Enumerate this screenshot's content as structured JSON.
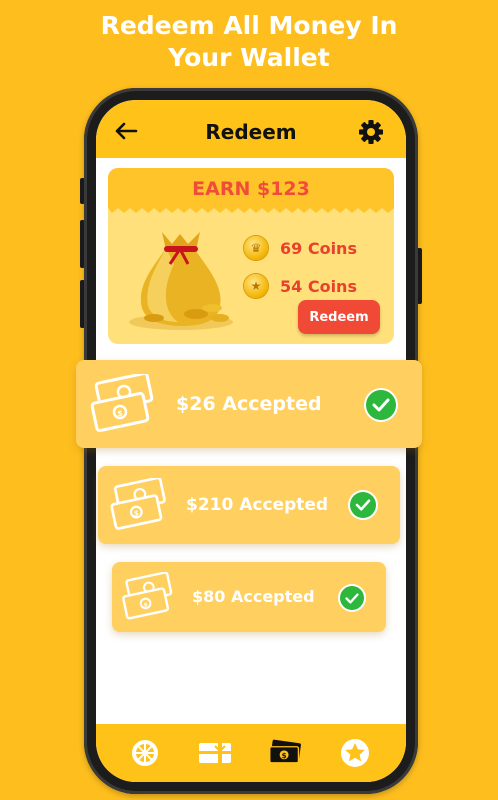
{
  "headline": {
    "line1": "Redeem All Money In",
    "line2": "Your Wallet"
  },
  "header": {
    "title": "Redeem"
  },
  "earn_card": {
    "title": "EARN $123",
    "coins": [
      {
        "value": "69 Coins",
        "icon": "crown-coin-icon"
      },
      {
        "value": "54 Coins",
        "icon": "star-coin-icon"
      }
    ],
    "redeem_label": "Redeem"
  },
  "accepted": [
    {
      "text": "$26 Accepted"
    },
    {
      "text": "$210 Accepted"
    },
    {
      "text": "$80 Accepted"
    }
  ],
  "bottom_nav": [
    {
      "icon": "wheel-icon"
    },
    {
      "icon": "gift-card-icon"
    },
    {
      "icon": "money-icon"
    },
    {
      "icon": "star-icon"
    }
  ],
  "colors": {
    "background": "#FDBE1E",
    "bar": "#FFC219",
    "accent_red": "#F04A37",
    "check_green": "#2DB83D"
  }
}
